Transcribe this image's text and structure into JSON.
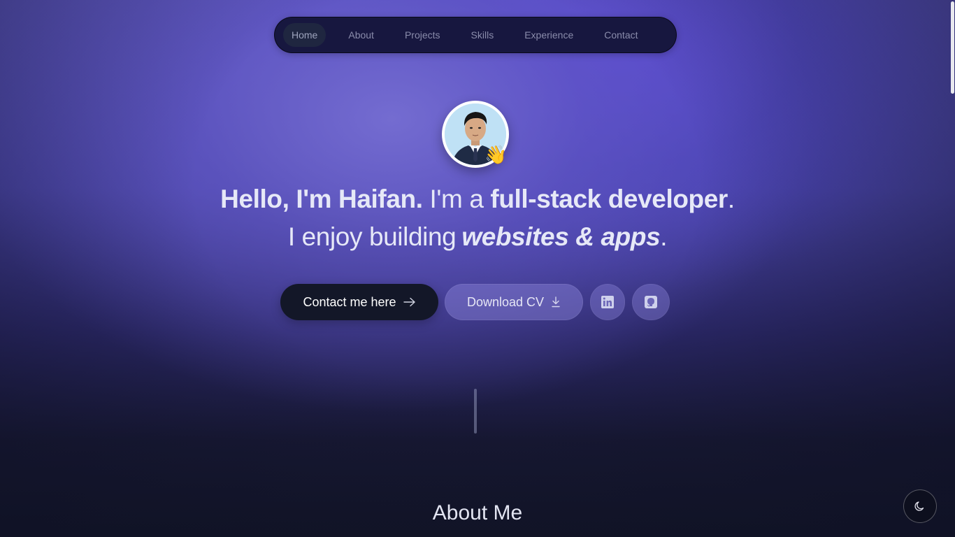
{
  "nav": {
    "items": [
      {
        "label": "Home",
        "active": true
      },
      {
        "label": "About",
        "active": false
      },
      {
        "label": "Projects",
        "active": false
      },
      {
        "label": "Skills",
        "active": false
      },
      {
        "label": "Experience",
        "active": false
      },
      {
        "label": "Contact",
        "active": false
      }
    ]
  },
  "hero": {
    "greeting": "Hello, I'm Haifan.",
    "im_a": " I'm a ",
    "role": "full-stack developer",
    "period1": ".",
    "enjoy": "I enjoy building",
    "building_what": "websites & apps",
    "period2": ".",
    "wave_emoji": "👋",
    "avatar_icon": "profile-photo"
  },
  "actions": {
    "contact_label": "Contact me here",
    "contact_icon": "arrow-right-icon",
    "cv_label": "Download CV",
    "cv_icon": "download-icon",
    "linkedin_icon": "linkedin-icon",
    "github_icon": "github-icon"
  },
  "about": {
    "title": "About Me"
  },
  "theme_toggle": {
    "icon": "moon-icon"
  },
  "colors": {
    "nav_bg": "#17173f",
    "contact_bg": "#131728",
    "accent_purple": "#5d56c2"
  }
}
